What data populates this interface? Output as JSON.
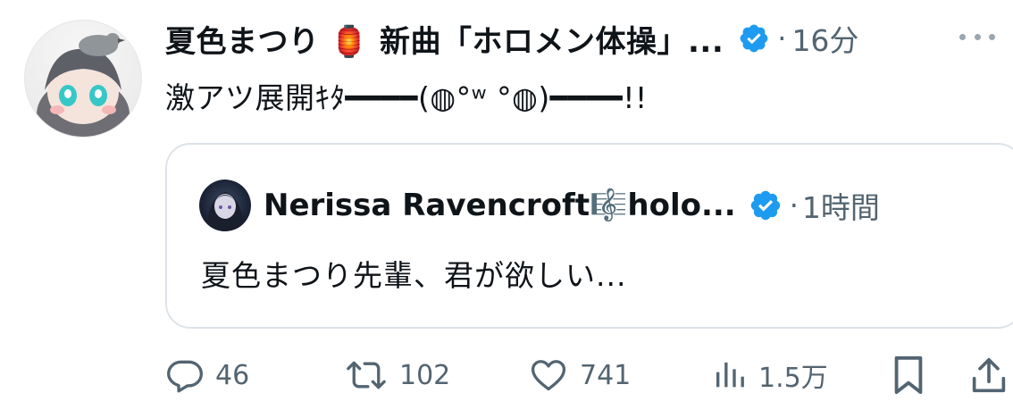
{
  "post": {
    "author_name": "夏色まつり 🏮 新曲「ホロメン体操」...",
    "time": "16分",
    "separator": "·",
    "text": "激アツ展開ｷﾀ━━━━(◍°ʷ °◍)━━━━!!"
  },
  "quoted_post": {
    "author_name": "Nerissa Ravencroft🎼holo...",
    "time": "1時間",
    "separator": "·",
    "text": "夏色まつり先輩、君が欲しい..."
  },
  "actions": {
    "reply_count": "46",
    "repost_count": "102",
    "like_count": "741",
    "views_count": "1.5万"
  },
  "colors": {
    "verified": "#1d9bf0",
    "muted": "#536471",
    "border": "#dde3e8"
  },
  "icons": [
    "more-icon",
    "verified-icon",
    "reply-icon",
    "repost-icon",
    "like-icon",
    "views-icon",
    "bookmark-icon",
    "share-icon"
  ]
}
